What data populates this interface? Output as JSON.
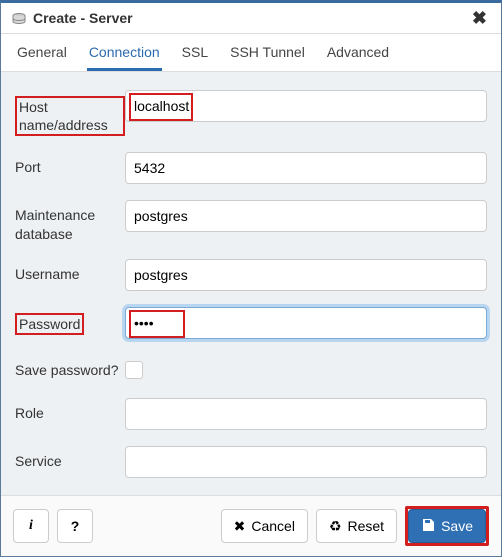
{
  "header": {
    "title": "Create - Server"
  },
  "tabs": {
    "general": "General",
    "connection": "Connection",
    "ssl": "SSL",
    "ssh": "SSH Tunnel",
    "advanced": "Advanced"
  },
  "form": {
    "host_label": "Host name/address",
    "host_value": "localhost",
    "port_label": "Port",
    "port_value": "5432",
    "maintdb_label": "Maintenance database",
    "maintdb_value": "postgres",
    "username_label": "Username",
    "username_value": "postgres",
    "password_label": "Password",
    "password_value": "••••",
    "savepw_label": "Save password?",
    "role_label": "Role",
    "role_value": "",
    "service_label": "Service",
    "service_value": ""
  },
  "footer": {
    "info": "i",
    "help": "?",
    "cancel": "Cancel",
    "reset": "Reset",
    "save": "Save"
  }
}
